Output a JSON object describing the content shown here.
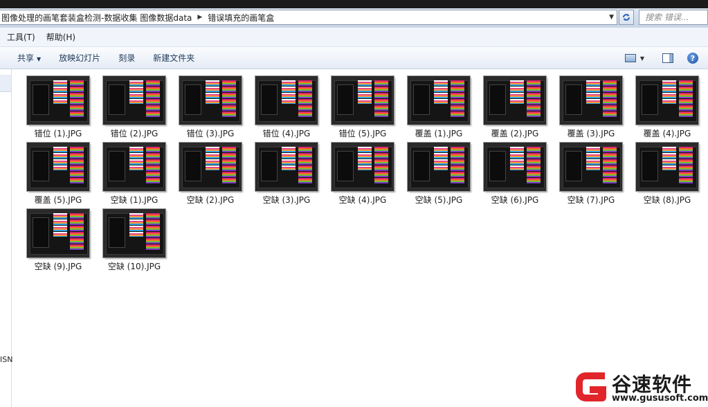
{
  "address": {
    "segments": [
      "图像处理的画笔套装盒检测-数据收集",
      "图像数据data",
      "错误填充的画笔盒"
    ],
    "separator_icon": "triangle-right"
  },
  "search": {
    "placeholder": "搜索 错误..."
  },
  "menu": {
    "items": [
      "工具(T)",
      "帮助(H)"
    ]
  },
  "toolbar": {
    "share_label": "共享",
    "slideshow_label": "放映幻灯片",
    "burn_label": "刻录",
    "new_folder_label": "新建文件夹"
  },
  "nav": {
    "partial_text": "ISN"
  },
  "files": [
    "错位 (1).JPG",
    "错位 (2).JPG",
    "错位 (3).JPG",
    "错位 (4).JPG",
    "错位 (5).JPG",
    "覆盖 (1).JPG",
    "覆盖 (2).JPG",
    "覆盖 (3).JPG",
    "覆盖 (4).JPG",
    "覆盖 (5).JPG",
    "空缺 (1).JPG",
    "空缺 (2).JPG",
    "空缺 (3).JPG",
    "空缺 (4).JPG",
    "空缺 (5).JPG",
    "空缺 (6).JPG",
    "空缺 (7).JPG",
    "空缺 (8).JPG",
    "空缺 (9).JPG",
    "空缺 (10).JPG"
  ],
  "watermark": {
    "name": "谷速软件",
    "url": "www.gususoft.com",
    "color": "#e0262b"
  },
  "colors": {
    "toolbar_text": "#1e395b",
    "accent": "#1d4f9d"
  }
}
